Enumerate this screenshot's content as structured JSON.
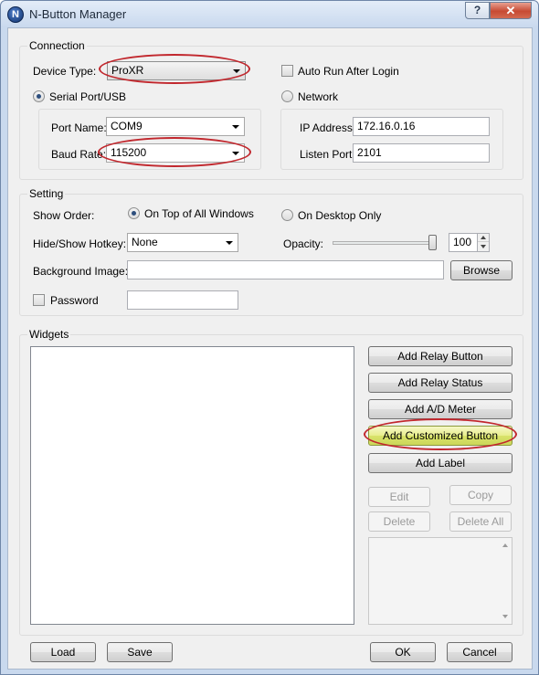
{
  "window": {
    "title": "N-Button Manager",
    "help_label": "?",
    "close_label": "✕",
    "icon_letter": "N"
  },
  "connection": {
    "group_title": "Connection",
    "device_type_label": "Device Type:",
    "device_type_value": "ProXR",
    "auto_run_label": "Auto Run After Login",
    "serial_label": "Serial Port/USB",
    "network_label": "Network",
    "port_name_label": "Port Name:",
    "port_name_value": "COM9",
    "baud_rate_label": "Baud Rate:",
    "baud_rate_value": "115200",
    "ip_label": "IP Address:",
    "ip_value": "172.16.0.16",
    "listen_port_label": "Listen Port:",
    "listen_port_value": "2101"
  },
  "setting": {
    "group_title": "Setting",
    "show_order_label": "Show Order:",
    "on_top_label": "On Top of All Windows",
    "desktop_only_label": "On Desktop Only",
    "hotkey_label": "Hide/Show Hotkey:",
    "hotkey_value": "None",
    "opacity_label": "Opacity:",
    "opacity_value": "100",
    "background_label": "Background Image:",
    "background_value": "",
    "browse_label": "Browse",
    "password_label": "Password",
    "password_value": ""
  },
  "widgets": {
    "group_title": "Widgets",
    "add_relay_button": "Add Relay Button",
    "add_relay_status": "Add Relay Status",
    "add_ad_meter": "Add A/D Meter",
    "add_customized_button": "Add Customized Button",
    "add_label": "Add Label",
    "edit": "Edit",
    "copy": "Copy",
    "delete": "Delete",
    "delete_all": "Delete All"
  },
  "footer": {
    "load": "Load",
    "save": "Save",
    "ok": "OK",
    "cancel": "Cancel"
  },
  "colors": {
    "highlight_oval": "#c1272d",
    "highlight_button": "#dce56e"
  }
}
